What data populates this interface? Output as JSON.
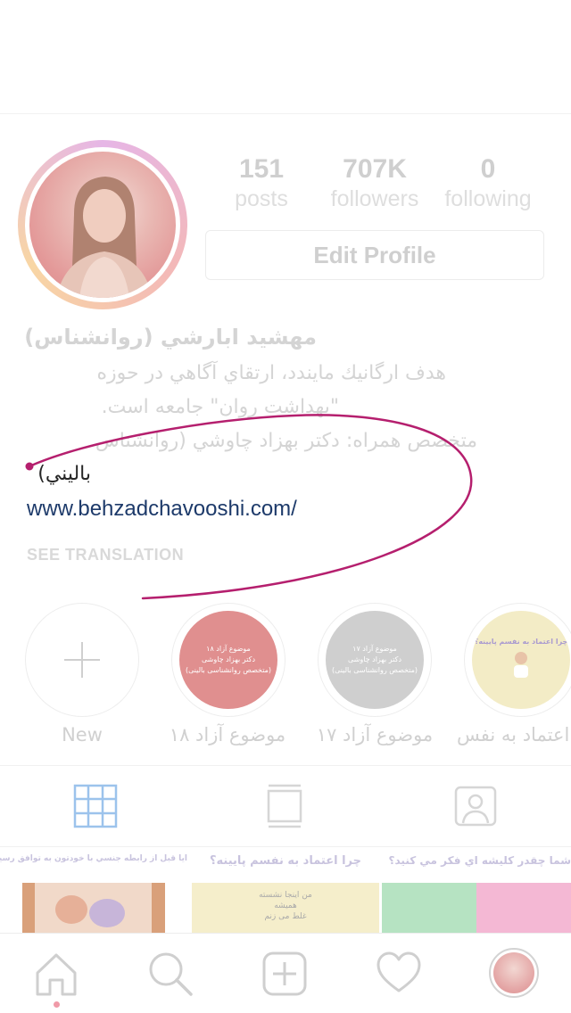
{
  "profile": {
    "stats": [
      {
        "value": "151",
        "label": "posts"
      },
      {
        "value": "707K",
        "label": "followers"
      },
      {
        "value": "0",
        "label": "following"
      }
    ],
    "edit_profile_label": "Edit Profile",
    "name": "مهشيد ابارشي (روانشناس)",
    "bio_lines": [
      "هدف ارگانيك مايندد، ارتقاي آگاهي در حوزه",
      "\"بهداشت روان\" جامعه است.",
      "متخصص همراه: دكتر بهزاد چاوشي (روانشناس",
      "باليني)"
    ],
    "website": "www.behzadchavooshi.com/",
    "see_translation": "SEE TRANSLATION"
  },
  "highlights": [
    {
      "label": "New",
      "type": "new"
    },
    {
      "label": "موضوع آزاد ۱۸",
      "cover_lines": [
        "موضوع آزاد ۱۸",
        "دکتر بهزاد چاوشی",
        "(متخصص روانشناسی بالینی)"
      ],
      "color": "#e08f8f"
    },
    {
      "label": "موضوع آزاد ۱۷",
      "cover_lines": [
        "موضوع آزاد ۱۷",
        "دکتر بهزاد چاوشی",
        "(متخصص روانشناسی بالینی)"
      ],
      "color": "#cfcfcf"
    },
    {
      "label": "اعتماد به نفس",
      "cover_lines": [
        "چرا اعتماد به نفسم پایینه؟"
      ],
      "color": "#f3ecc6"
    }
  ],
  "posts": [
    {
      "title": "ايا قبل از رابطه جنسي با خودتون به توافق رسيدين؟"
    },
    {
      "title": "چرا اعتماد به نفسم پایینه؟",
      "img_text": [
        "من اینجا نشسته",
        "همیشه",
        "غلط می زنم"
      ]
    },
    {
      "title": "شما چقدر كليشه اي فكر مي كنيد؟"
    }
  ],
  "colors": {
    "annotation": "#b51f6e",
    "link": "#1d3a6a"
  }
}
